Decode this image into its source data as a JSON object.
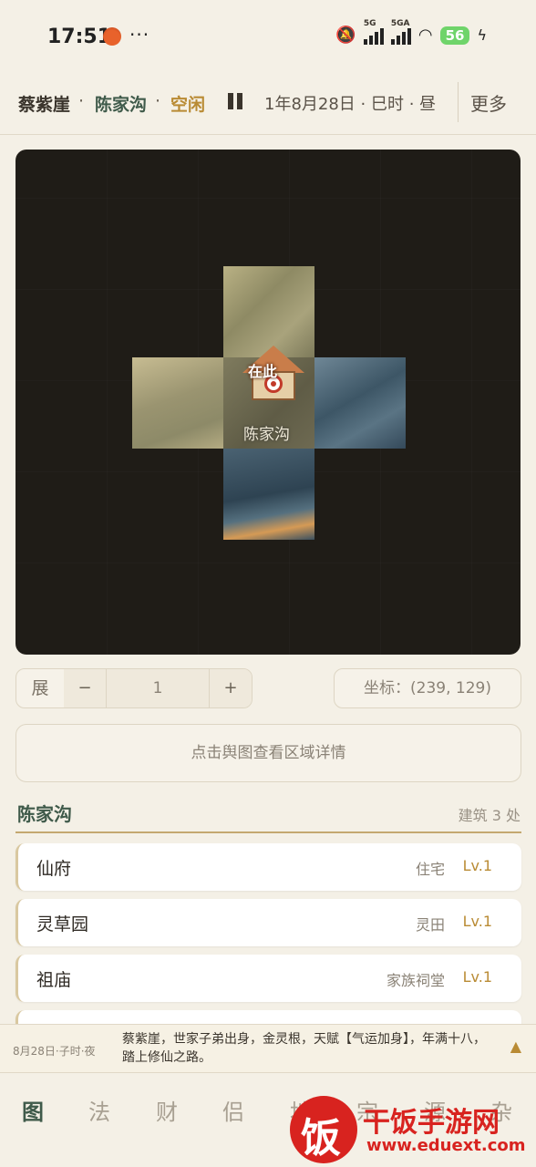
{
  "status_bar": {
    "time": "17:51",
    "dots": "···",
    "signal1": "5G",
    "signal2": "5GA",
    "battery": "56"
  },
  "header": {
    "character": "蔡紫崖",
    "separator": "·",
    "location": "陈家沟",
    "state": "空闲",
    "date": "1年8月28日 · 巳时 · 昼",
    "more": "更多"
  },
  "map": {
    "here_label": "在此",
    "tile_name": "陈家沟"
  },
  "controls": {
    "zoom_label": "展",
    "minus": "−",
    "zoom_value": "1",
    "plus": "+",
    "coord": "坐标：(239, 129)"
  },
  "region_hint": "点击舆图查看区域详情",
  "section": {
    "title": "陈家沟",
    "count": "建筑 3 处"
  },
  "buildings": [
    {
      "name": "仙府",
      "type": "住宅",
      "level": "Lv.1"
    },
    {
      "name": "灵草园",
      "type": "灵田",
      "level": "Lv.1"
    },
    {
      "name": "祖庙",
      "type": "家族祠堂",
      "level": "Lv.1"
    }
  ],
  "log": {
    "time": "8月28日·子时·夜",
    "text": "蔡紫崖，世家子弟出身，金灵根，天赋【气运加身】，年满十八，踏上修仙之路。",
    "toggle": "▲"
  },
  "nav": [
    "图",
    "法",
    "财",
    "侣",
    "地",
    "宗",
    "源",
    "杂"
  ],
  "watermark": {
    "glyph": "饭",
    "title": "干饭手游网",
    "url": "www.eduext.com"
  }
}
